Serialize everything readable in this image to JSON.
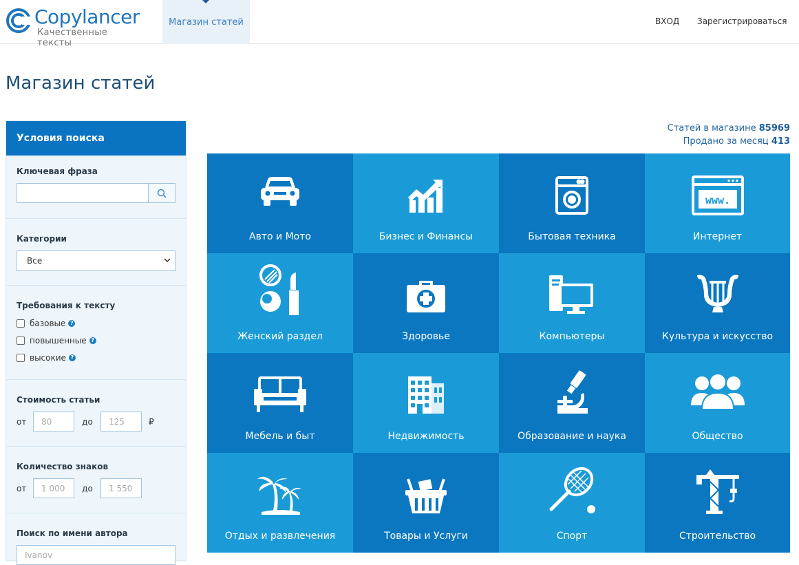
{
  "header": {
    "logo_name": "Copylancer",
    "logo_sub": "Качественные тексты",
    "nav_tab": "Магазин статей",
    "login": "ВХОД",
    "register": "Зарегистрироваться"
  },
  "page_title": "Магазин статей",
  "sidebar": {
    "title": "Условия поиска",
    "keyword": {
      "label": "Ключевая фраза",
      "value": ""
    },
    "category": {
      "label": "Категории",
      "selected": "Все"
    },
    "requirements": {
      "label": "Требования к тексту",
      "options": [
        "базовые",
        "повышенные",
        "высокие"
      ]
    },
    "price": {
      "label": "Стоимость статьи",
      "from_label": "от",
      "to_label": "до",
      "from_placeholder": "80",
      "to_placeholder": "125",
      "currency": "₽"
    },
    "chars": {
      "label": "Количество знаков",
      "from_label": "от",
      "to_label": "до",
      "from_placeholder": "1 000",
      "to_placeholder": "1 550"
    },
    "author": {
      "label": "Поиск по имени автора",
      "placeholder": "Ivanov"
    }
  },
  "stats": {
    "in_store_label": "Статей в магазине",
    "in_store_value": "85969",
    "sold_label": "Продано за месяц",
    "sold_value": "413"
  },
  "categories": [
    {
      "label": "Авто и Мото",
      "icon": "car-icon"
    },
    {
      "label": "Бизнес и Финансы",
      "icon": "business-chart-icon"
    },
    {
      "label": "Бытовая техника",
      "icon": "washing-machine-icon"
    },
    {
      "label": "Интернет",
      "icon": "browser-www-icon"
    },
    {
      "label": "Женский раздел",
      "icon": "cosmetics-icon"
    },
    {
      "label": "Здоровье",
      "icon": "medical-kit-icon"
    },
    {
      "label": "Компьютеры",
      "icon": "computer-icon"
    },
    {
      "label": "Культура и искусство",
      "icon": "lyre-icon"
    },
    {
      "label": "Мебель и быт",
      "icon": "sofa-icon"
    },
    {
      "label": "Недвижимость",
      "icon": "buildings-icon"
    },
    {
      "label": "Образование и наука",
      "icon": "microscope-icon"
    },
    {
      "label": "Общество",
      "icon": "people-icon"
    },
    {
      "label": "Отдых и развлечения",
      "icon": "palm-trees-icon"
    },
    {
      "label": "Товары и Услуги",
      "icon": "shopping-basket-icon"
    },
    {
      "label": "Спорт",
      "icon": "tennis-racket-icon"
    },
    {
      "label": "Строительство",
      "icon": "crane-icon"
    }
  ]
}
